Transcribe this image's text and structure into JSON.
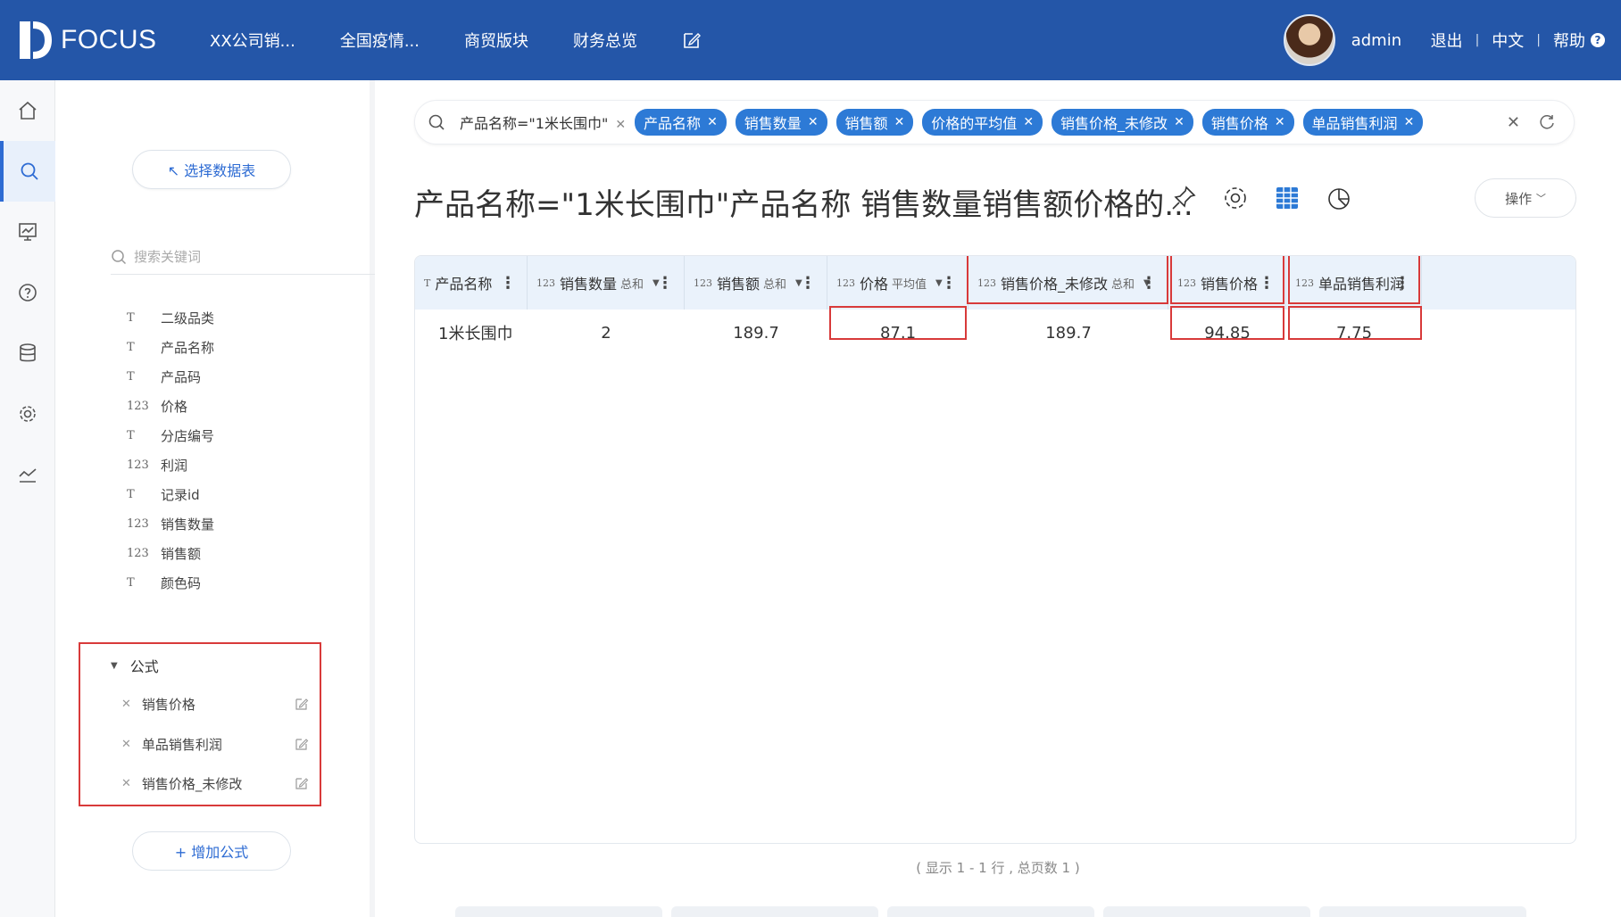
{
  "app": {
    "logo_text": "FOCUS"
  },
  "nav": {
    "items": [
      "XX公司销...",
      "全国疫情...",
      "商贸版块",
      "财务总览"
    ],
    "edit_icon": "edit-icon"
  },
  "user": {
    "name": "admin",
    "logout": "退出",
    "language": "中文",
    "help": "帮助",
    "help_glyph": "?"
  },
  "rail": {
    "icons": [
      "home-icon",
      "search-icon",
      "dashboard-icon",
      "help-icon",
      "database-icon",
      "settings-icon",
      "trend-icon"
    ],
    "active": 1
  },
  "panel": {
    "select_table": "↖ 选择数据表",
    "search_placeholder": "搜索关键词",
    "fields": [
      {
        "type": "T",
        "name": "二级品类"
      },
      {
        "type": "T",
        "name": "产品名称"
      },
      {
        "type": "T",
        "name": "产品码"
      },
      {
        "type": "123",
        "name": "价格"
      },
      {
        "type": "T",
        "name": "分店编号"
      },
      {
        "type": "123",
        "name": "利润"
      },
      {
        "type": "T",
        "name": "记录id"
      },
      {
        "type": "123",
        "name": "销售数量"
      },
      {
        "type": "123",
        "name": "销售额"
      },
      {
        "type": "T",
        "name": "颜色码"
      }
    ],
    "formula_section": "公式",
    "formulas": [
      "销售价格",
      "单品销售利润",
      "销售价格_未修改"
    ],
    "add_formula": "+ 增加公式"
  },
  "search": {
    "condition": "产品名称=\"1米长围巾\"",
    "chips": [
      "产品名称",
      "销售数量",
      "销售额",
      "价格的平均值",
      "销售价格_未修改",
      "销售价格",
      "单品销售利润"
    ]
  },
  "title": "产品名称=\"1米长围巾\"产品名称 销售数量销售额价格的...",
  "toolbar": {
    "operate": "操作"
  },
  "table": {
    "columns": [
      {
        "type": "T",
        "name": "产品名称",
        "agg": "",
        "dropdown": false
      },
      {
        "type": "123",
        "name": "销售数量",
        "agg": "总和",
        "dropdown": true
      },
      {
        "type": "123",
        "name": "销售额",
        "agg": "总和",
        "dropdown": true
      },
      {
        "type": "123",
        "name": "价格",
        "agg": "平均值",
        "dropdown": true
      },
      {
        "type": "123",
        "name": "销售价格_未修改",
        "agg": "总和",
        "dropdown": true
      },
      {
        "type": "123",
        "name": "销售价格",
        "agg": "",
        "dropdown": false
      },
      {
        "type": "123",
        "name": "单品销售利润",
        "agg": "",
        "dropdown": false
      }
    ],
    "rows": [
      [
        "1米长围巾",
        "2",
        "189.7",
        "87.1",
        "189.7",
        "94.85",
        "7.75"
      ]
    ],
    "footer": "( 显示 1 - 1 行 , 总页数 1 )"
  },
  "colors": {
    "topbar": "#2456a8",
    "chip": "#2d7ad6",
    "highlight": "#d83a3a",
    "header_bg": "#eaf2fb"
  }
}
